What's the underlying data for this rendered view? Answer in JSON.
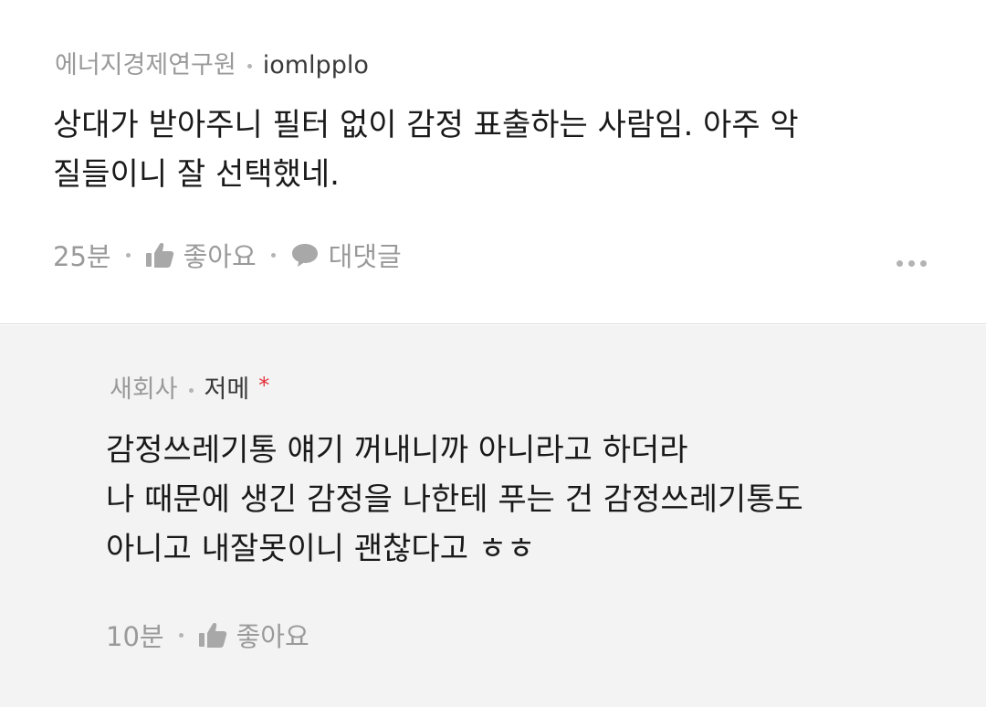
{
  "comments": [
    {
      "company": "에너지경제연구원",
      "author": "iomlpplo",
      "text": "상대가 받아주니 필터 없이 감정 표출하는 사람임. 아주 악\n질들이니 잘 선택했네.",
      "time": "25분",
      "like_label": "좋아요",
      "reply_label": "대댓글"
    },
    {
      "company": "새회사",
      "author": "저메",
      "author_marker": "*",
      "text": "감정쓰레기통 얘기 꺼내니까 아니라고 하더라\n나 때문에 생긴 감정을 나한테 푸는 건 감정쓰레기통도\n아니고 내잘못이니 괜찮다고 ㅎㅎ",
      "time": "10분",
      "like_label": "좋아요"
    }
  ],
  "colors": {
    "reply_background": "#f3f3f3",
    "muted_text": "#9a9a9a",
    "body_text": "#1a1a1a",
    "author_marker": "#e0323b"
  },
  "icons": {
    "like": "thumbs-up-icon",
    "reply": "speech-bubble-icon",
    "more": "more-dots-icon"
  }
}
